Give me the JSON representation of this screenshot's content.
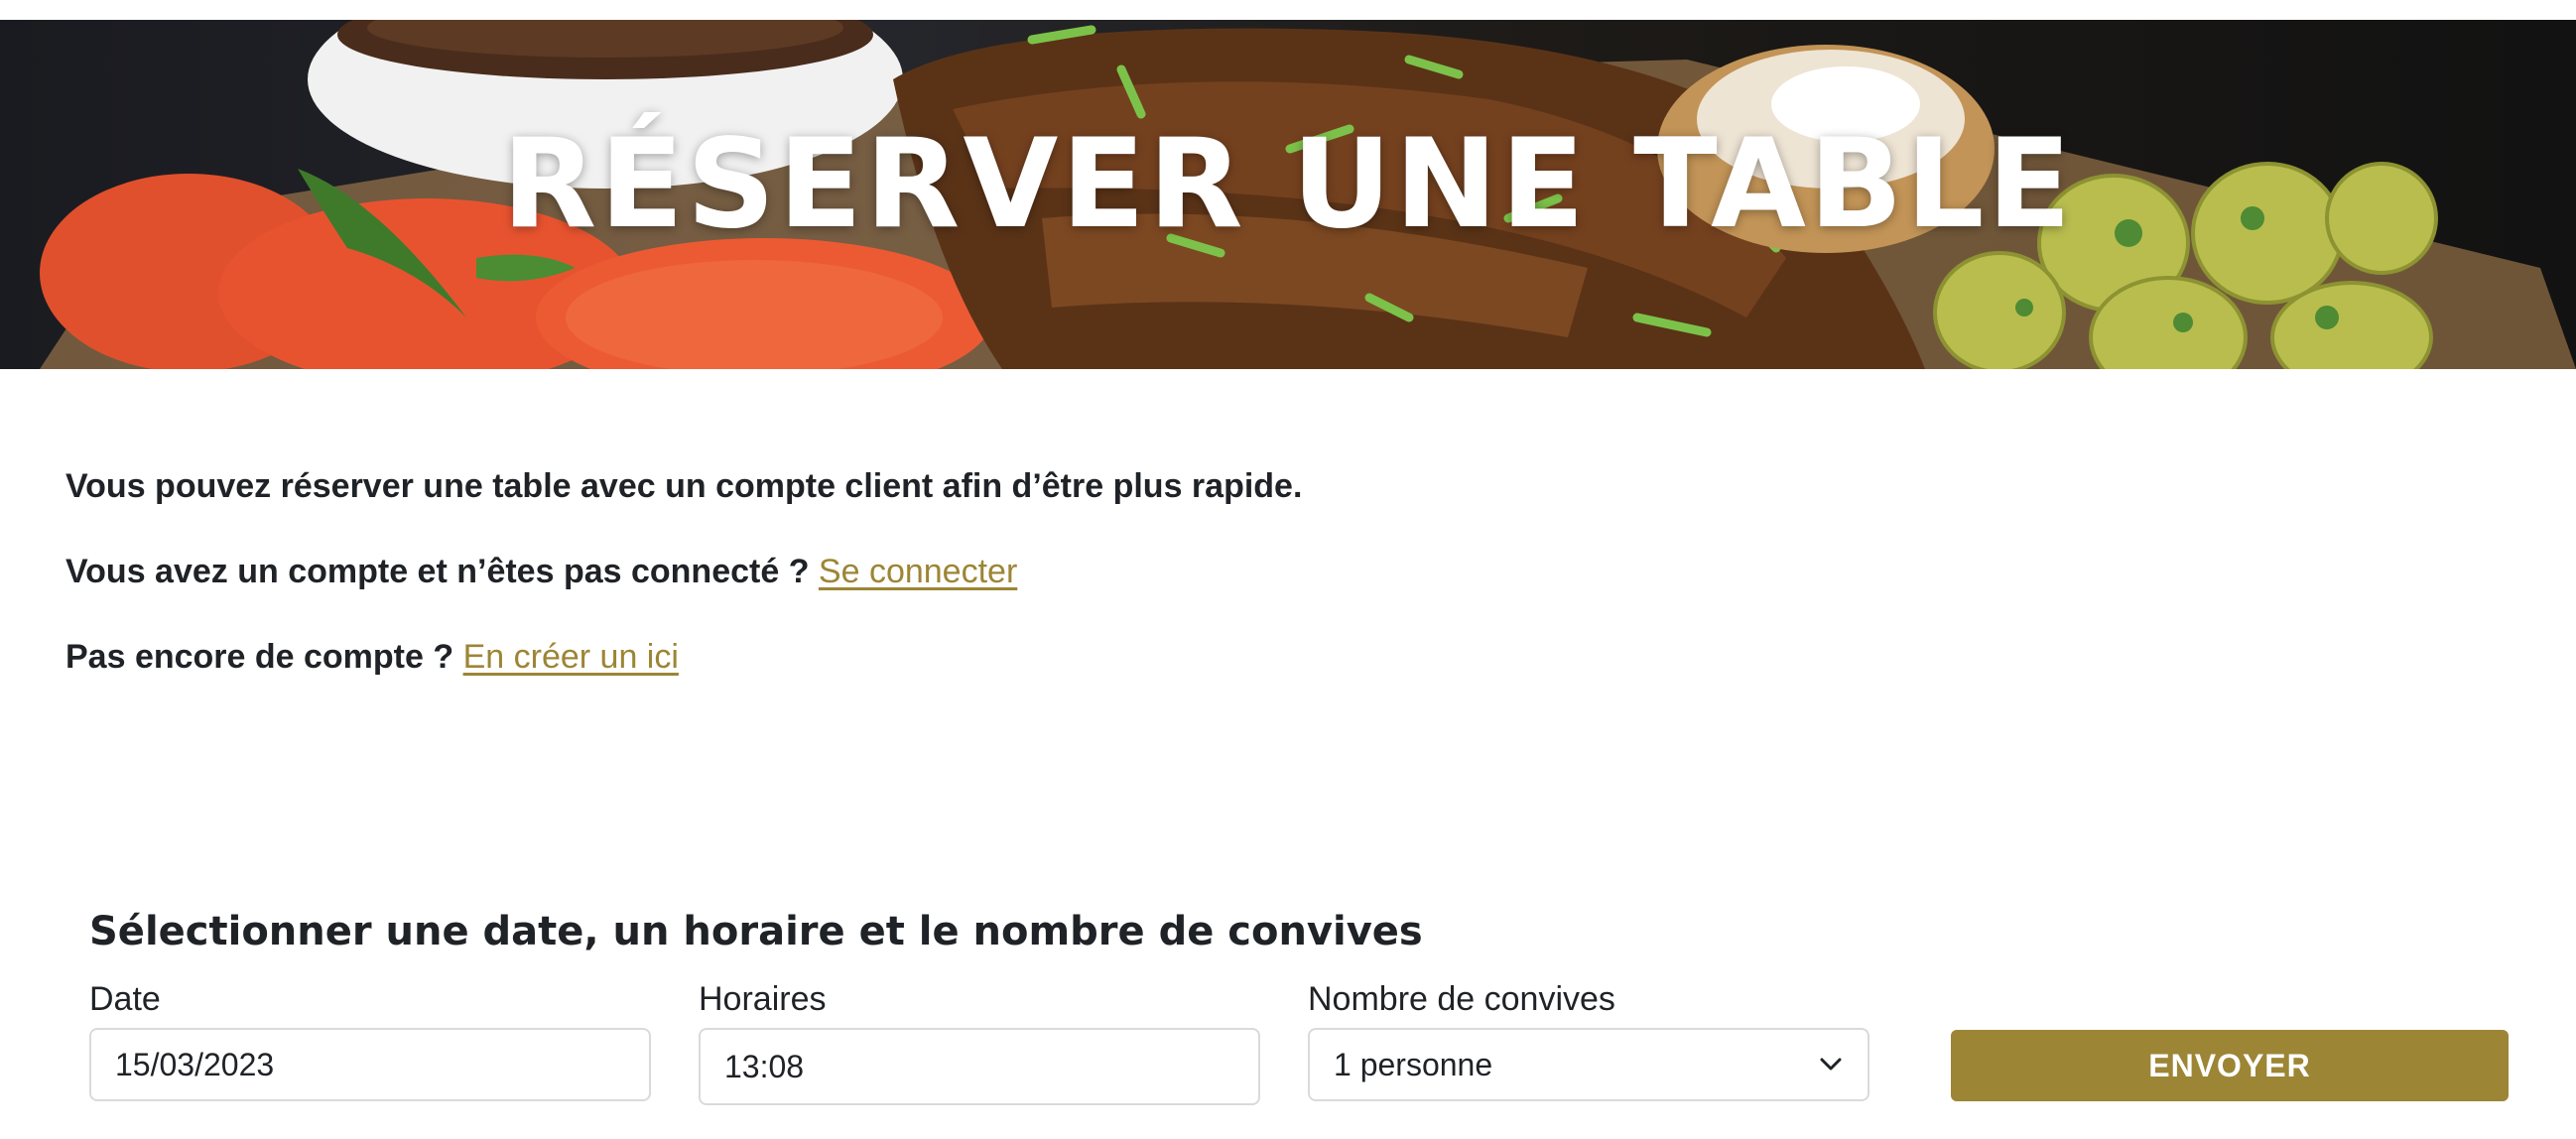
{
  "hero": {
    "title": "RÉSERVER UNE TABLE"
  },
  "intro": {
    "line1": "Vous pouvez réserver une table avec un compte client afin d’être plus rapide.",
    "line2_text": "Vous avez un compte et n’êtes pas connecté ?",
    "line2_link": "Se connecter",
    "line3_text": "Pas encore de compte ?",
    "line3_link": "En créer un ici"
  },
  "form": {
    "title": "Sélectionner une date, un horaire et le nombre de convives",
    "date": {
      "label": "Date",
      "value": "15/03/2023"
    },
    "time": {
      "label": "Horaires",
      "value": "13:08"
    },
    "guests": {
      "label": "Nombre de convives",
      "value": "1 personne"
    },
    "submit_label": "ENVOYER"
  },
  "colors": {
    "accent": "#9c8535",
    "text": "#1f2226",
    "border": "#d9dadd"
  }
}
